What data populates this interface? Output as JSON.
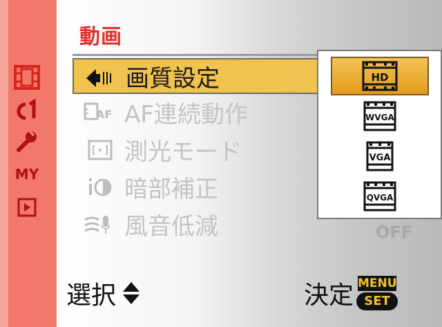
{
  "screen": {
    "title": "動画"
  },
  "sidebar": {
    "items": [
      {
        "icon": "movie-film-icon"
      },
      {
        "icon": "custom-c1-icon"
      },
      {
        "icon": "wrench-setup-icon"
      },
      {
        "label": "MY"
      },
      {
        "icon": "playback-icon"
      }
    ]
  },
  "menu": {
    "items": [
      {
        "label": "画質設定",
        "icon": "diamond-arrow-icon",
        "selected": true
      },
      {
        "label": "AF連続動作",
        "icon_text": "AF",
        "icon": "film-af-icon"
      },
      {
        "label": "測光モード",
        "icon": "metering-icon"
      },
      {
        "label": "暗部補正",
        "icon": "shadow-correction-icon"
      },
      {
        "label": "風音低減",
        "icon": "wind-noise-icon",
        "value": "OFF"
      }
    ]
  },
  "popup": {
    "options": [
      {
        "label": "HD",
        "selected": true
      },
      {
        "label": "WVGA"
      },
      {
        "label": "VGA"
      },
      {
        "label": "QVGA"
      }
    ]
  },
  "footer": {
    "select_label": "選択",
    "confirm_label": "決定",
    "menu_badge_top": "MENU",
    "menu_badge_bottom": "SET"
  },
  "colors": {
    "sidebar": "#f2786a",
    "accent_red": "#e1302a",
    "highlight_yellow": "#f0c24e",
    "option_orange": "#e39a1e"
  }
}
